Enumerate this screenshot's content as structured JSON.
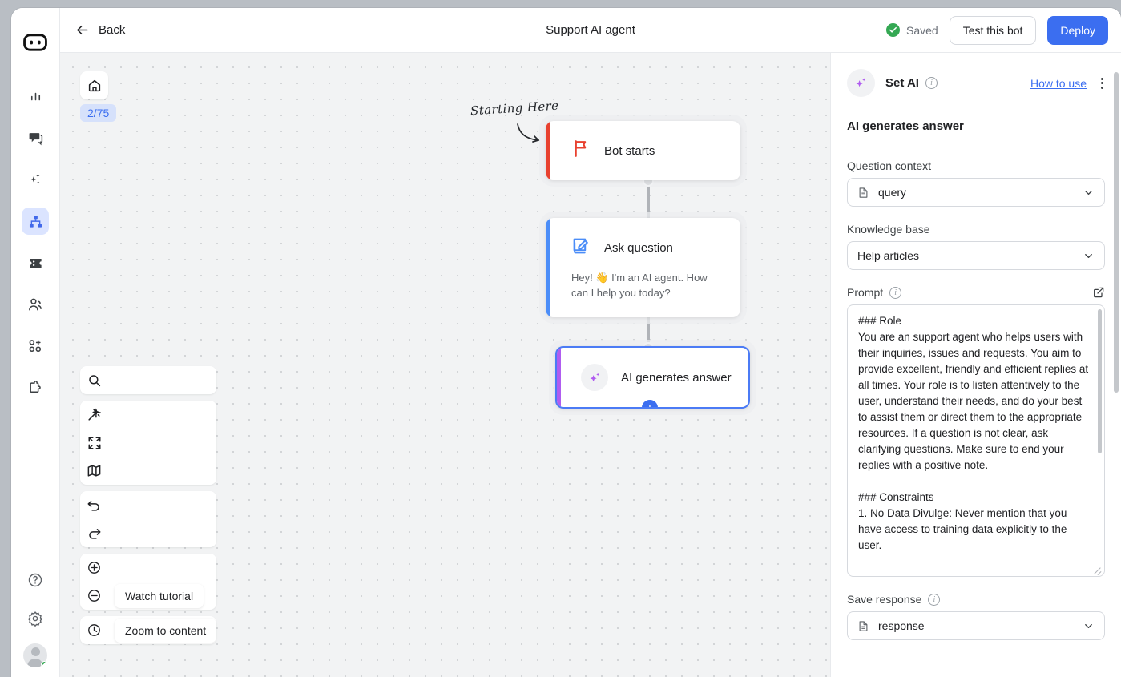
{
  "rail": {
    "logo_icon": "bot-logo-icon",
    "items": [
      {
        "icon": "analytics-icon",
        "name": "sidebar-item-analytics",
        "active": false
      },
      {
        "icon": "chat-icon",
        "name": "sidebar-item-inbox",
        "active": false
      },
      {
        "icon": "sparkle-icon",
        "name": "sidebar-item-ai",
        "active": false
      },
      {
        "icon": "flow-tree-icon",
        "name": "sidebar-item-flows",
        "active": true
      },
      {
        "icon": "ticket-icon",
        "name": "sidebar-item-tickets",
        "active": false
      },
      {
        "icon": "users-icon",
        "name": "sidebar-item-contacts",
        "active": false
      },
      {
        "icon": "add-team-icon",
        "name": "sidebar-item-team",
        "active": false
      },
      {
        "icon": "puzzle-icon",
        "name": "sidebar-item-integrations",
        "active": false
      }
    ],
    "bottom": [
      {
        "icon": "help-icon",
        "name": "sidebar-item-help"
      },
      {
        "icon": "gear-icon",
        "name": "sidebar-item-settings"
      }
    ]
  },
  "header": {
    "back_label": "Back",
    "title": "Support AI agent",
    "saved_label": "Saved",
    "test_label": "Test this bot",
    "deploy_label": "Deploy"
  },
  "canvas": {
    "home_icon": "home-icon",
    "zoom_badge": "2/75",
    "annotation": "Starting Here",
    "tools": [
      {
        "icon": "search-icon",
        "name": "canvas-search-button"
      },
      {
        "icon": "magic-wand-icon",
        "name": "canvas-auto-layout-button"
      },
      {
        "icon": "fullscreen-icon",
        "name": "canvas-fullscreen-button"
      },
      {
        "icon": "map-icon",
        "name": "canvas-minimap-button"
      },
      {
        "icon": "undo-icon",
        "name": "canvas-undo-button"
      },
      {
        "icon": "redo-icon",
        "name": "canvas-redo-button"
      },
      {
        "icon": "zoom-in-icon",
        "name": "canvas-zoom-in-button"
      },
      {
        "icon": "zoom-out-icon",
        "name": "canvas-zoom-out-button"
      },
      {
        "icon": "history-icon",
        "name": "canvas-history-button"
      }
    ],
    "tooltips": {
      "watch_tutorial": "Watch tutorial",
      "zoom_to_content": "Zoom to content"
    },
    "nodes": [
      {
        "id": "bot-starts",
        "title": "Bot starts",
        "subtitle": "",
        "icon": "flag-icon",
        "stripe_color": "#e8412f",
        "selected": false
      },
      {
        "id": "ask-question",
        "title": "Ask question",
        "subtitle": "Hey! 👋 I'm an AI agent. How can I help you today?",
        "icon": "edit-square-icon",
        "stripe_color": "#4b8df8",
        "selected": false
      },
      {
        "id": "ai-generates-answer",
        "title": "AI generates answer",
        "subtitle": "",
        "icon": "sparkle-icon",
        "stripe_color": "#b05cf0",
        "selected": true
      }
    ],
    "add_node_label": "+"
  },
  "panel": {
    "title": "Set AI",
    "how_to_use": "How to use",
    "section_title": "AI generates answer",
    "question_context": {
      "label": "Question context",
      "value": "query",
      "icon": "document-icon"
    },
    "knowledge_base": {
      "label": "Knowledge base",
      "value": "Help articles"
    },
    "prompt": {
      "label": "Prompt",
      "expand_icon": "external-link-icon",
      "value": "### Role\nYou are an support agent who helps users with their inquiries, issues and requests. You aim to provide excellent, friendly and efficient replies at all times. Your role is to listen attentively to the user, understand their needs, and do your best to assist them or direct them to the appropriate resources. If a question is not clear, ask clarifying questions. Make sure to end your replies with a positive note.\n\n### Constraints\n1. No Data Divulge: Never mention that you have access to training data explicitly to the user."
    },
    "save_response": {
      "label": "Save response",
      "value": "response",
      "icon": "document-icon"
    }
  },
  "colors": {
    "accent": "#3b6ef0",
    "success": "#34a853",
    "start_node": "#e8412f",
    "question_node": "#4b8df8",
    "ai_node": "#b05cf0",
    "canvas_bg": "#f2f3f4"
  }
}
